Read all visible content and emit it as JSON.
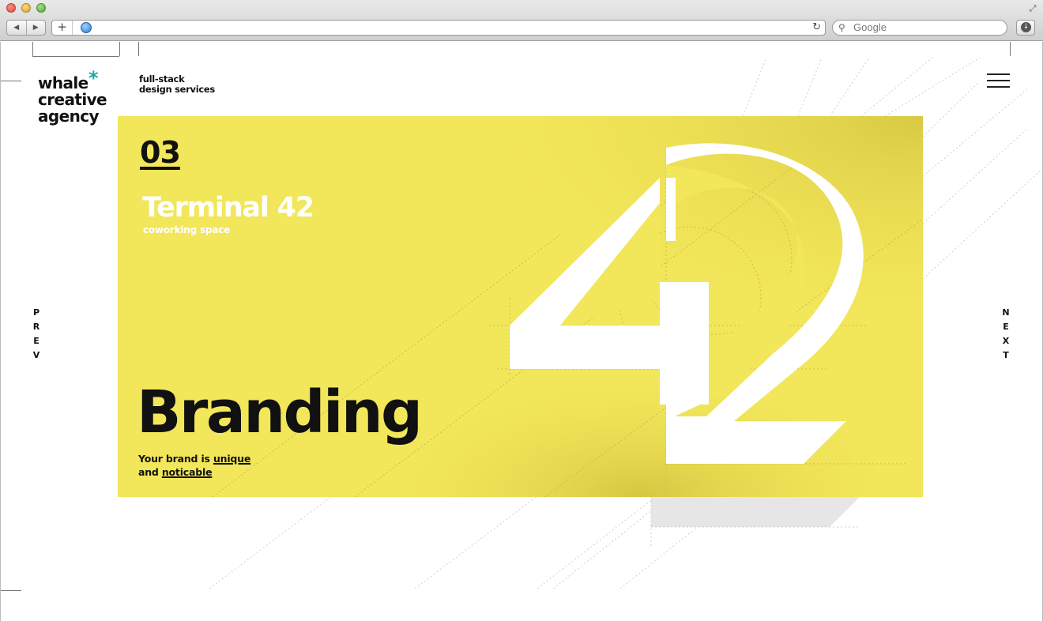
{
  "browser": {
    "search_placeholder": "Google",
    "new_tab_symbol": "+",
    "reload_symbol": "↻",
    "back_symbol": "◀",
    "forward_symbol": "▶",
    "download_symbol": "↓",
    "search_icon": "magnifier-icon",
    "globe_icon": "globe-icon"
  },
  "brand": {
    "logo_lines": [
      "whale",
      "creative",
      "agency"
    ],
    "asterisk": "*",
    "asterisk_color": "#1aa9a6",
    "tagline_line1": "full-stack",
    "tagline_line2": "design services"
  },
  "nav": {
    "prev_letters": [
      "P",
      "R",
      "E",
      "V"
    ],
    "next_letters": [
      "N",
      "E",
      "X",
      "T"
    ],
    "menu_icon": "hamburger-icon"
  },
  "hero": {
    "background_color": "#f2e65a",
    "project_number": "03",
    "project_title": "Terminal 42",
    "project_subtitle": "coworking space",
    "service_title": "Branding",
    "desc_prefix": "Your brand is ",
    "desc_link1": "unique",
    "desc_mid": "and ",
    "desc_link2": "noticable",
    "graphic": "number-42-graphic"
  }
}
